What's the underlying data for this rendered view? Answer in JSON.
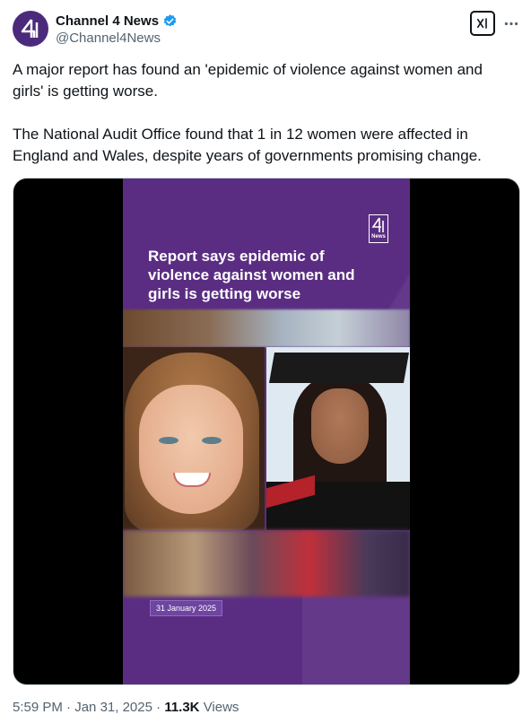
{
  "author": {
    "display_name": "Channel 4 News",
    "handle": "@Channel4News",
    "verified": true,
    "avatar_icon": "channel4-logo-icon",
    "avatar_color": "#4b2a7b",
    "verified_color": "#1d9bf0"
  },
  "actions": {
    "grok_icon": "grok-icon",
    "more_icon": "more-options-icon"
  },
  "tweet": {
    "paragraph_1": "A major report has found an 'epidemic of violence against women and girls' is getting worse.",
    "paragraph_2": "The National Audit Office found that 1 in 12 women were affected in England and Wales, despite years of governments promising change."
  },
  "media": {
    "logo_text": "News",
    "headline": "Report says epidemic of violence against women and girls is getting worse",
    "date_tag": "31 January 2025",
    "frame_color": "#5a2d82"
  },
  "meta": {
    "time": "5:59 PM",
    "separator": "·",
    "date": "Jan 31, 2025",
    "views_count": "11.3K",
    "views_label": "Views"
  }
}
